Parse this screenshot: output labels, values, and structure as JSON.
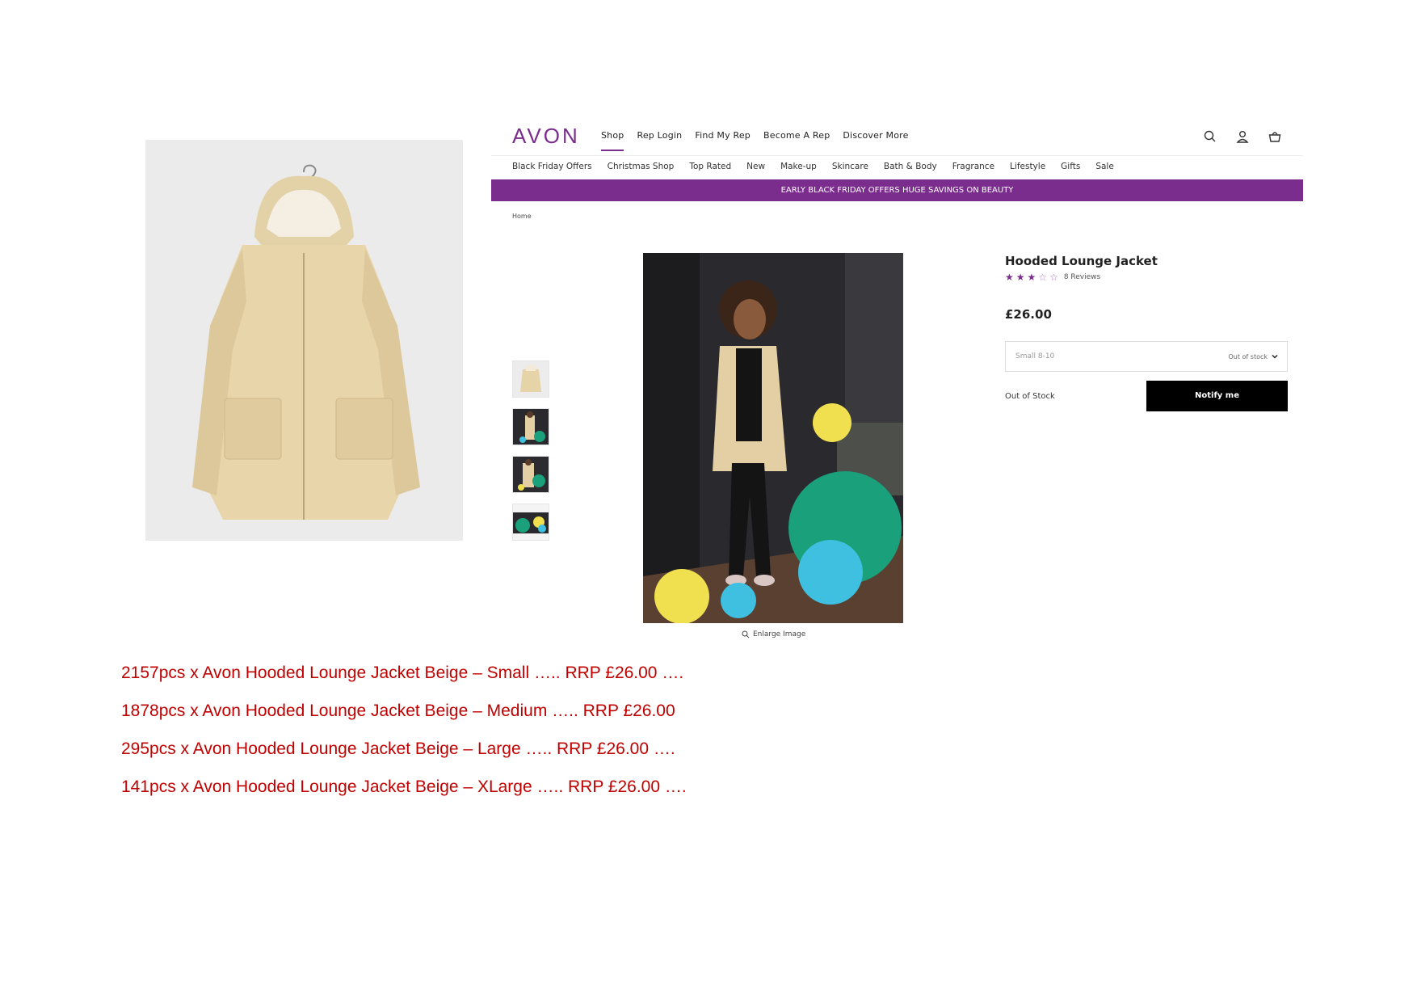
{
  "site": {
    "logo": "AVON",
    "brand_color": "#7b2d8e",
    "main_nav": [
      "Shop",
      "Rep Login",
      "Find My Rep",
      "Become A Rep",
      "Discover More"
    ],
    "main_nav_active": "Shop",
    "tool_icons": [
      "search-icon",
      "account-icon",
      "basket-icon"
    ],
    "sub_nav": [
      "Black Friday Offers",
      "Christmas Shop",
      "Top Rated",
      "New",
      "Make-up",
      "Skincare",
      "Bath & Body",
      "Fragrance",
      "Lifestyle",
      "Gifts",
      "Sale"
    ],
    "banner": "EARLY BLACK FRIDAY OFFERS  HUGE SAVINGS ON BEAUTY",
    "breadcrumb": "Home",
    "enlarge_label": "Enlarge Image"
  },
  "product": {
    "title": "Hooded Lounge Jacket",
    "rating_stars": 3,
    "rating_max": 5,
    "reviews": "8 Reviews",
    "price": "£26.00",
    "size_selected": "Small 8-10",
    "size_status": "Out of stock",
    "stock_label": "Out of Stock",
    "notify_label": "Notify me"
  },
  "stock_lines": [
    "2157pcs x Avon Hooded Lounge Jacket Beige – Small ….. RRP £26.00 ….",
    "1878pcs x Avon Hooded Lounge Jacket Beige – Medium ….. RRP £26.00",
    "295pcs x Avon Hooded Lounge Jacket Beige – Large ….. RRP £26.00 ….",
    "141pcs x Avon Hooded Lounge Jacket Beige – XLarge ….. RRP £26.00 …."
  ]
}
